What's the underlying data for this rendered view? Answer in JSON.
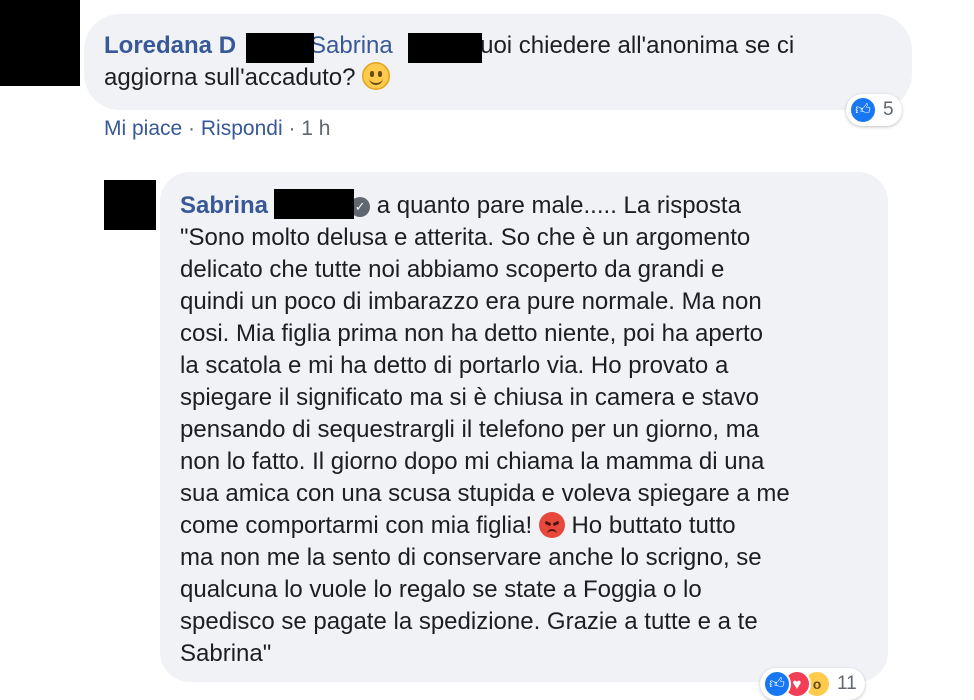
{
  "comment": {
    "author": "Loredana D",
    "mention": "Sabrina",
    "line1": "puoi chiedere all'anonima se ci",
    "line2": "aggiorna sull'accaduto?",
    "emoji": "slightly-smiling-face",
    "reaction_count": "5",
    "actions": {
      "like": "Mi piace",
      "dot1": "·",
      "reply": "Rispondi",
      "dot2": "·",
      "time": "1 h"
    }
  },
  "reply": {
    "author": "Sabrina",
    "verified_icon": "check-badge-icon",
    "lines": [
      "a quanto pare male..... La risposta",
      "\"Sono molto delusa e atterita. So che è un argomento",
      "delicato che tutte noi abbiamo scoperto da grandi e",
      "quindi un poco di imbarazzo era pure normale. Ma non",
      "cosi. Mia figlia prima non ha detto niente, poi ha aperto",
      "la scatola e mi ha detto di portarlo via. Ho provato a",
      "spiegare il significato ma si è chiusa in camera e stavo",
      "pensando di sequestrargli il telefono per un giorno, ma",
      "non lo fatto. Il giorno dopo mi chiama la mamma di una",
      "sua amica con una scusa stupida e voleva spiegare a me",
      "come comportarmi con mia figlia!",
      "Ho buttato tutto",
      "ma non me la sento di conservare anche lo scrigno, se",
      "qualcuna lo vuole lo regalo se state a Foggia o lo",
      "spedisco se pagate la spedizione. Grazie a tutte e a te",
      "Sabrina\""
    ],
    "emoji": "angry-face",
    "reaction_count": "11",
    "reactions": [
      "like",
      "love",
      "wow"
    ]
  },
  "colors": {
    "link": "#385898",
    "bubble": "#f0f2f5",
    "muted": "#606770",
    "like_blue": "#1877f2"
  }
}
